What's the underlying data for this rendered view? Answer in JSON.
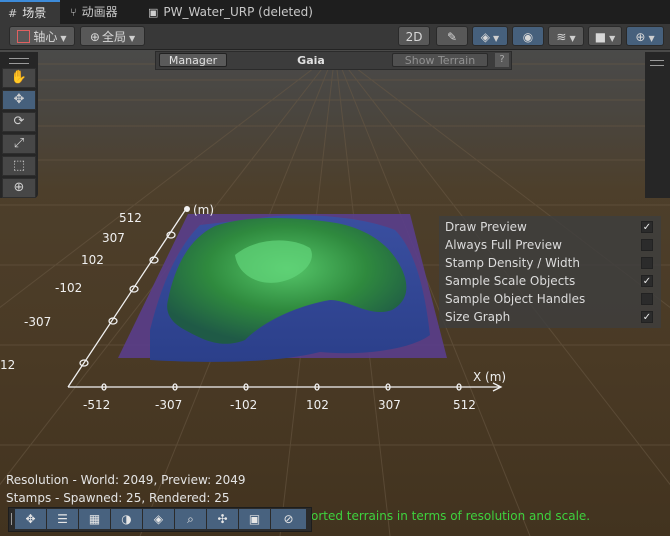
{
  "tabs": [
    {
      "label": "场景",
      "icon": "grid-icon"
    },
    {
      "label": "动画器",
      "icon": "animator-icon"
    },
    {
      "label": "PW_Water_URP (deleted)",
      "icon": "prefab-icon"
    }
  ],
  "toolbar": {
    "pivot_label": "轴心",
    "global_label": "全局"
  },
  "gaia": {
    "manager_label": "Manager",
    "title": "Gaia",
    "show_terrain_label": "Show Terrain",
    "help_label": "?"
  },
  "preview_options": [
    {
      "label": "Draw Preview",
      "checked": true
    },
    {
      "label": "Always Full Preview",
      "checked": false
    },
    {
      "label": "Stamp Density / Width",
      "checked": false
    },
    {
      "label": "Sample Scale Objects",
      "checked": true
    },
    {
      "label": "Sample Object Handles",
      "checked": false
    },
    {
      "label": "Size Graph",
      "checked": true
    }
  ],
  "graph": {
    "x_label": "X (m)",
    "z_label": "(m)",
    "x_ticks": [
      "-512",
      "-307",
      "-102",
      "102",
      "307",
      "512"
    ],
    "z_ticks": [
      "512",
      "307",
      "102",
      "-102",
      "-307",
      "12"
    ]
  },
  "stats": {
    "resolution": "Resolution - World: 2049, Preview: 2049",
    "stamps": "Stamps - Spawned: 25, Rendered: 25",
    "warning": "orted terrains in terms of resolution and scale."
  },
  "colors": {
    "accent": "#46607c",
    "warning": "#3ed23e"
  }
}
